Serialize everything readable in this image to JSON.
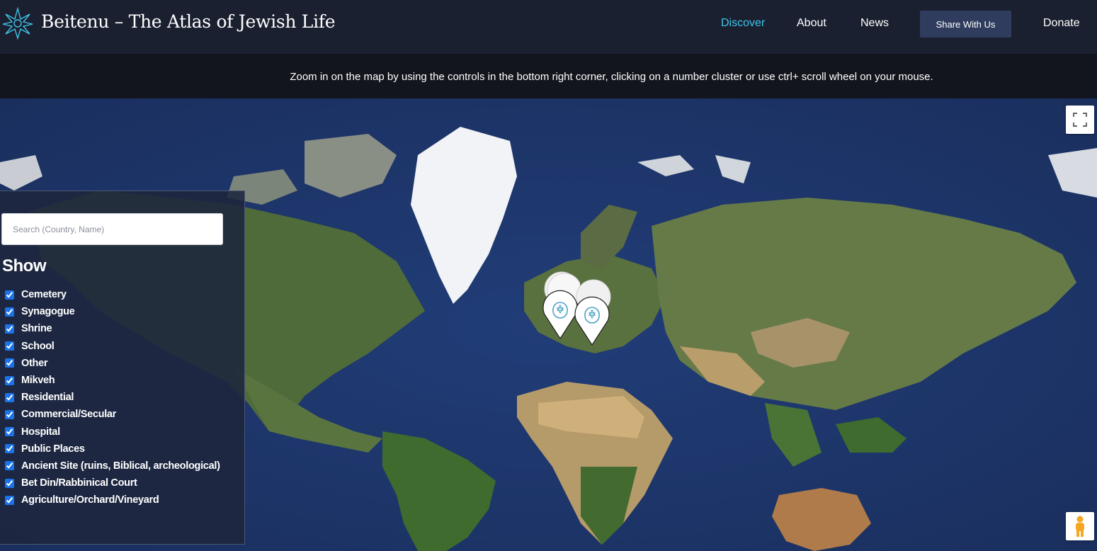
{
  "header": {
    "title": "Beitenu – The Atlas of Jewish Life",
    "nav": {
      "discover": "Discover",
      "about": "About",
      "news": "News",
      "share": "Share With Us",
      "donate": "Donate"
    },
    "accent_color": "#3fc4e8",
    "background_color": "#1b2030"
  },
  "banner": {
    "text": "Zoom in on the map by using the controls in the bottom right corner, clicking on a number cluster or use ctrl+ scroll wheel on your mouse."
  },
  "map": {
    "type": "satellite world map",
    "controls": [
      "fullscreen-icon",
      "pegman-icon"
    ],
    "markers": [
      {
        "icon": "star-of-david-icon",
        "region": "Western Europe"
      },
      {
        "icon": "star-of-david-icon",
        "region": "Central Europe"
      }
    ]
  },
  "filters": {
    "search_placeholder": "Search (Country, Name)",
    "show_label": "Show",
    "items": [
      {
        "label": "Cemetery",
        "checked": true
      },
      {
        "label": "Synagogue",
        "checked": true
      },
      {
        "label": "Shrine",
        "checked": true
      },
      {
        "label": "School",
        "checked": true
      },
      {
        "label": "Other",
        "checked": true
      },
      {
        "label": "Mikveh",
        "checked": true
      },
      {
        "label": "Residential",
        "checked": true
      },
      {
        "label": "Commercial/Secular",
        "checked": true
      },
      {
        "label": "Hospital",
        "checked": true
      },
      {
        "label": "Public Places",
        "checked": true
      },
      {
        "label": "Ancient Site (ruins, Biblical, archeological)",
        "checked": true
      },
      {
        "label": "Bet Din/Rabbinical Court",
        "checked": true
      },
      {
        "label": "Agriculture/Orchard/Vineyard",
        "checked": true
      }
    ]
  }
}
